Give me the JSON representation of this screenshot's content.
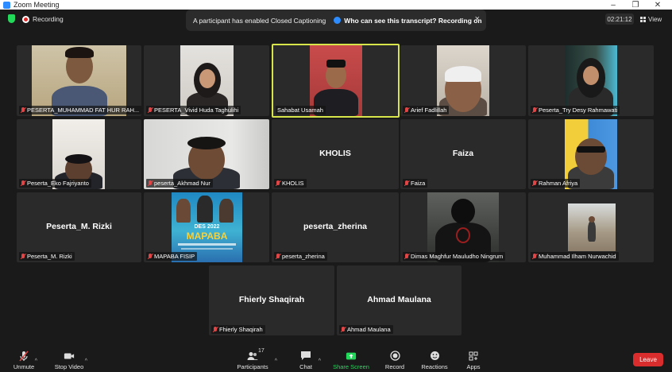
{
  "window": {
    "title": "Zoom Meeting"
  },
  "status": {
    "recording_label": "Recording",
    "timer": "02:21:12",
    "view_label": "View"
  },
  "banner": {
    "text": "A participant has enabled Closed Captioning",
    "link": "Who can see this transcript? Recording on",
    "close": "×"
  },
  "tiles": [
    {
      "name": "PESERTA_MUHAMMAD FAT HUR RAH...",
      "video": true
    },
    {
      "name": "PESERTA_Vivid Huda Taghulihi",
      "video": true
    },
    {
      "name": "Sahabat Usamah",
      "video": true,
      "active": true
    },
    {
      "name": "Arief Fadlillah",
      "video": true
    },
    {
      "name": "Peserta_Try Desy Rahmawati",
      "video": true
    },
    {
      "name": "Peserta_Eko Fajriyanto",
      "video": true
    },
    {
      "name": "peserta_Akhmad Nur",
      "video": true
    },
    {
      "name": "KHOLIS",
      "center": "KHOLIS"
    },
    {
      "name": "Faiza",
      "center": "Faiza"
    },
    {
      "name": "Rahman Afriya",
      "video": true
    },
    {
      "name": "Peserta_M. Rizki",
      "center": "Peserta_M. Rizki"
    },
    {
      "name": "MAPABA FISIP",
      "video": true
    },
    {
      "name": "peserta_zherina",
      "center": "peserta_zherina"
    },
    {
      "name": "Dimas Maghfur Mauludho Ningrum",
      "video": true
    },
    {
      "name": "Muhammad Ilham Nurwachid",
      "video": true
    },
    {
      "name": "Fhierly Shaqirah",
      "center": "Fhierly Shaqirah"
    },
    {
      "name": "Ahmad Maulana",
      "center": "Ahmad Maulana"
    }
  ],
  "poster": {
    "line1": "DES 2022",
    "line2": "MAPABA"
  },
  "toolbar": {
    "unmute": "Unmute",
    "stop_video": "Stop Video",
    "participants": "Participants",
    "participants_count": "17",
    "chat": "Chat",
    "share": "Share Screen",
    "record": "Record",
    "reactions": "Reactions",
    "apps": "Apps",
    "leave": "Leave"
  },
  "colors": {
    "active_speaker": "#d7e54a",
    "leave": "#d92d2d",
    "share": "#23d959",
    "muted": "#e04646"
  }
}
